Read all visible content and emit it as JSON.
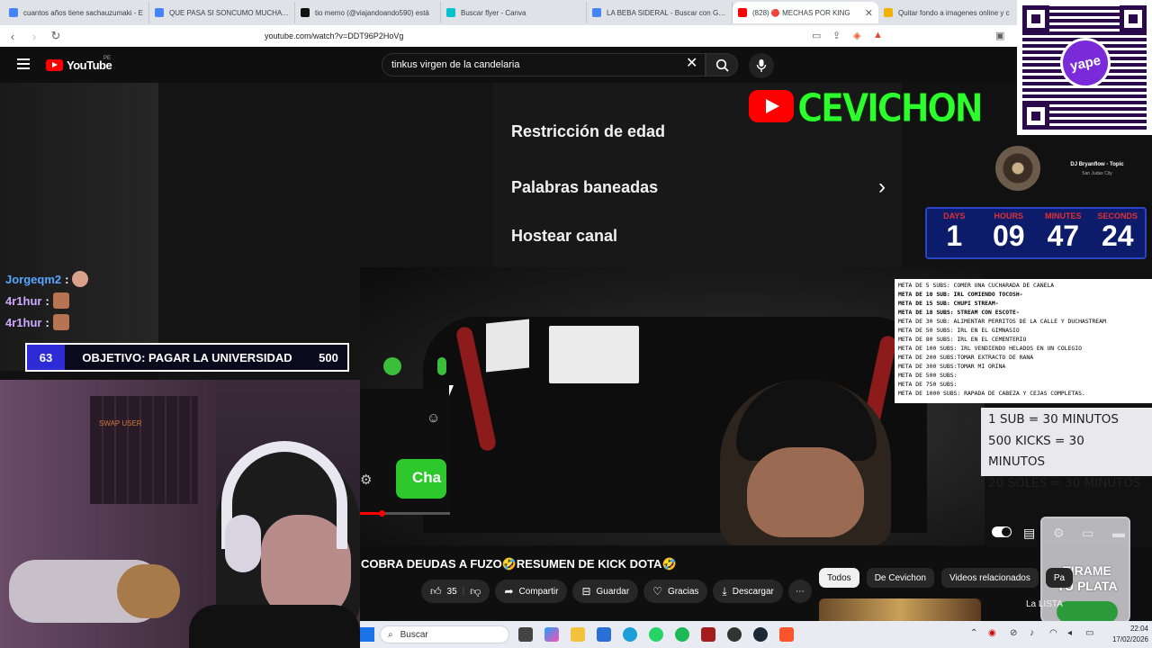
{
  "browser": {
    "tabs": [
      {
        "title": "cuantos años tiene sachauzumaki - E",
        "color": "#4285f4",
        "active": false
      },
      {
        "title": "QUE PASA SI SONCUMO MUCHA CA",
        "color": "#4285f4",
        "active": false
      },
      {
        "title": "tio memo (@viajandoando590) está",
        "color": "#111111",
        "active": false
      },
      {
        "title": "Buscar flyer - Canva",
        "color": "#00c4cc",
        "active": false
      },
      {
        "title": "LA BEBA SIDERAL - Buscar con Goog",
        "color": "#4285f4",
        "active": false
      },
      {
        "title": "(828) 🔴 MECHAS POR KING",
        "color": "#ff0000",
        "active": true
      },
      {
        "title": "Quitar fondo a imagenes online y c",
        "color": "#f0b400",
        "active": false
      }
    ],
    "url": "youtube.com/watch?v=DDT96P2HoVg"
  },
  "youtube": {
    "logo_text": "YouTube",
    "country_code": "PE",
    "search_value": "tinkus virgen de la candelaria"
  },
  "stream": {
    "menu_items": [
      "Restricción de edad",
      "Palabras baneadas",
      "Hostear canal"
    ],
    "side_button": "Cha",
    "channel_banner": "CEVICHON",
    "chat": [
      {
        "user": "Jorgeqm2",
        "color": "#58a6ff"
      },
      {
        "user": "4r1hur",
        "color": "#cfa8ff"
      },
      {
        "user": "4r1hur",
        "color": "#cfa8ff"
      }
    ],
    "goal": {
      "current": "63",
      "label": "OBJETIVO: PAGAR LA UNIVERSIDAD",
      "target": "500"
    },
    "cam_sign": "SWAP USER",
    "music": {
      "title": "DJ Bryanflow - Topic",
      "subtitle": "San Judas City"
    },
    "countdown": [
      {
        "label": "DAYS",
        "value": "1"
      },
      {
        "label": "HOURS",
        "value": "09"
      },
      {
        "label": "MINUTES",
        "value": "47"
      },
      {
        "label": "SECONDS",
        "value": "24"
      }
    ],
    "metas": [
      {
        "text": "META DE 5 SUBS: COMER UNA CUCHARADA DE CANELA",
        "bold": false
      },
      {
        "text": "META DE 10 SUB: IRL COMIENDO TOCOSH-",
        "bold": true
      },
      {
        "text": "META DE 15 SUB: CHUPI STREAM-",
        "bold": true
      },
      {
        "text": "META DE 18 SUBS: STREAM CON ESCOTE-",
        "bold": true
      },
      {
        "text": "META DE 30 SUB:  ALIMENTAR PERRITOS DE LA CALLE Y DUCHASTREAM",
        "bold": false
      },
      {
        "text": "META DE 50 SUBS: IRL EN EL GIMNASIO",
        "bold": false
      },
      {
        "text": "META DE 80 SUBS: IRL EN EL CEMENTERIO",
        "bold": false
      },
      {
        "text": "META DE 100 SUBS: IRL VENDIENDO HELADOS EN UN COLEGIO",
        "bold": false
      },
      {
        "text": "META DE 200 SUBS:TOMAR EXTRACTO DE RANA",
        "bold": false
      },
      {
        "text": "META DE 300 SUBS:TOMAR MI ORINA",
        "bold": false
      },
      {
        "text": "META DE 500 SUBS:",
        "bold": false
      },
      {
        "text": "META DE 750 SUBS:",
        "bold": false
      },
      {
        "text": "META DE 1000 SUBS: RAPADA DE CABEZA Y CEJAS COMPLETAS.",
        "bold": false
      }
    ],
    "rates": [
      "1 SUB = 30 MINUTOS",
      "500 KICKS = 30 MINUTOS",
      "20 SOLES = 30 MINUTOS"
    ],
    "tip_jar": [
      "TIRAME",
      "TU PLATA"
    ],
    "qr_brand": "yape"
  },
  "video": {
    "title": "COBRA DEUDAS A FUZO🤣RESUMEN DE KICK DOTA🤣",
    "actions": {
      "likes": "35",
      "share": "Compartir",
      "save": "Guardar",
      "thanks": "Gracias",
      "download": "Descargar"
    },
    "chips": [
      "Todos",
      "De Cevichon",
      "Videos relacionados",
      "Pa"
    ],
    "rec_title": "La LISTA"
  },
  "taskbar": {
    "search_placeholder": "Buscar",
    "time": "22:04",
    "date": "17/02/2026"
  }
}
